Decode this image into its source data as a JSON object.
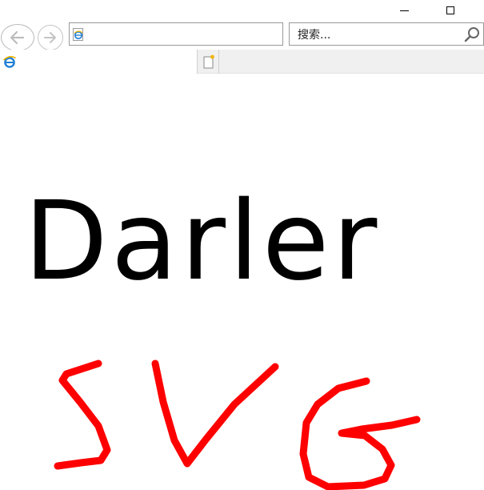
{
  "window": {
    "minimize_icon": "minimize-icon",
    "maximize_icon": "maximize-icon"
  },
  "nav": {
    "back_icon": "back-arrow-icon",
    "forward_icon": "forward-arrow-icon",
    "address_value": "",
    "search_placeholder": "搜索...",
    "search_icon": "magnifier-icon"
  },
  "tabs": {
    "active_tab_title": "",
    "tab_icon": "ie-logo-icon",
    "new_tab_icon": "new-tab-icon"
  },
  "page": {
    "heading": "Darler",
    "drawing_text": "SVG",
    "drawing_color": "#ff0000"
  }
}
